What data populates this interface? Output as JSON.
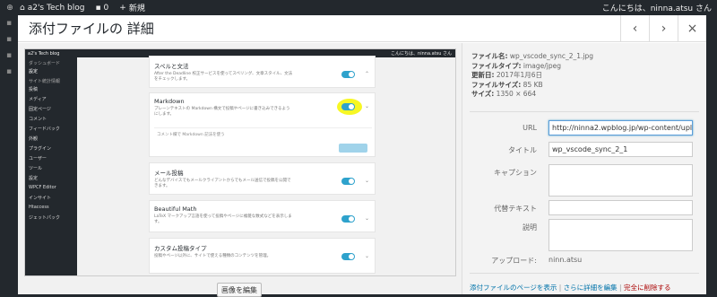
{
  "adminbar": {
    "site_name": "a2's Tech blog",
    "comments_count": "0",
    "new_label": "新規",
    "greeting": "こんにちは、ninna.atsu さん"
  },
  "modal": {
    "title": "添付ファイルの 詳細",
    "prev_icon": "‹",
    "next_icon": "›",
    "close_icon": "×",
    "edit_image_label": "画像を編集"
  },
  "file_info": {
    "filename_label": "ファイル名:",
    "filename": "wp_vscode_sync_2_1.jpg",
    "type_label": "ファイルタイプ:",
    "type": "image/jpeg",
    "updated_label": "更新日:",
    "updated": "2017年1月6日",
    "size_label": "ファイルサイズ:",
    "size": "85 KB",
    "dims_label": "サイズ:",
    "dims": "1350 × 664"
  },
  "fields": {
    "url_label": "URL",
    "url_value": "http://ninna2.wpblog.jp/wp-content/uploa",
    "title_label": "タイトル",
    "title_value": "wp_vscode_sync_2_1",
    "caption_label": "キャプション",
    "alt_label": "代替テキスト",
    "desc_label": "説明",
    "uploader_label": "アップロード:",
    "uploader_value": "ninn.atsu"
  },
  "links": {
    "view_page": "添付ファイルのページを表示",
    "sep1": " | ",
    "edit_more": "さらに詳細を編集",
    "sep2": " | ",
    "delete": "完全に削除する"
  },
  "shot": {
    "bar_site": "a2's Tech blog",
    "bar_greeting": "こんにちは、ninna.atsu さん",
    "menu": [
      "ダッシュボード",
      "設定",
      "サイト統計情報",
      "投稿",
      "メディア",
      "固定ページ",
      "コメント",
      "フィードバック",
      "外観",
      "プラグイン",
      "ユーザー",
      "ツール",
      "設定",
      "WPCF Editor",
      "インサイト",
      "Htaccess",
      "ジェットパック"
    ],
    "cards": [
      {
        "title": "スペルと文法",
        "desc": "After the Deadline 校正サービスを使ってスペリング、文章スタイル、文法をチェックします。"
      },
      {
        "title": "Markdown",
        "desc": "プレーンテキストの Markdown 構文で投稿やページに書き込みできるようにします。"
      },
      {
        "title": "メール投稿",
        "desc": "どんなデバイスでもメールクライアントからでもメール送信で投稿を公開できます。"
      },
      {
        "title": "Beautiful Math",
        "desc": "LaTeX マークアップ言語を使って投稿やページに複雑な数式などを表示します。"
      },
      {
        "title": "カスタム投稿タイプ",
        "desc": "投稿やページ以外に、サイトで使える種類のコンテンツを管理。"
      }
    ],
    "markdown_option": "コメント欄で Markdown 記法を使う"
  },
  "colors": {
    "accent": "#0073aa",
    "toggle": "#2ea2cc",
    "highlight": "#f6f60c",
    "delete": "#a00"
  }
}
